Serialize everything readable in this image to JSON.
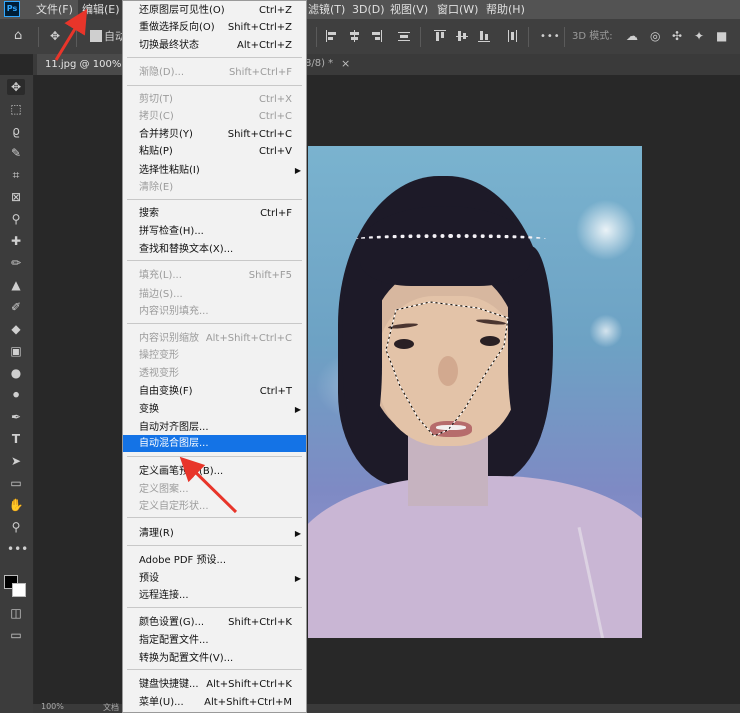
{
  "app": {
    "logo": "Ps"
  },
  "menubar": {
    "file": "文件(F)",
    "edit": "编辑(E)",
    "filter": "滤镜(T)",
    "threed": "3D(D)",
    "view": "视图(V)",
    "window": "窗口(W)",
    "help": "帮助(H)"
  },
  "options": {
    "auto_label": "自动",
    "threed_mode": "3D 模式:",
    "more": "•••"
  },
  "tabs": {
    "active": "11.jpg @ 100%(R",
    "second_suffix": "8/8) *",
    "close": "×"
  },
  "statusbar": {
    "zoom": "100%",
    "doc": "文档"
  },
  "edit_menu": {
    "items": [
      {
        "label": "还原图层可见性(O)",
        "shortcut": "Ctrl+Z",
        "disabled": false
      },
      {
        "label": "重做选择反向(O)",
        "shortcut": "Shift+Ctrl+Z",
        "disabled": false
      },
      {
        "label": "切换最终状态",
        "shortcut": "Alt+Ctrl+Z",
        "disabled": false
      },
      {
        "label": "渐隐(D)...",
        "shortcut": "Shift+Ctrl+F",
        "disabled": true
      },
      {
        "label": "剪切(T)",
        "shortcut": "Ctrl+X",
        "disabled": true
      },
      {
        "label": "拷贝(C)",
        "shortcut": "Ctrl+C",
        "disabled": true
      },
      {
        "label": "合并拷贝(Y)",
        "shortcut": "Shift+Ctrl+C",
        "disabled": false
      },
      {
        "label": "粘贴(P)",
        "shortcut": "Ctrl+V",
        "disabled": false
      },
      {
        "label": "选择性粘贴(I)",
        "shortcut": "",
        "disabled": false,
        "submenu": true
      },
      {
        "label": "清除(E)",
        "shortcut": "",
        "disabled": true
      },
      {
        "label": "搜索",
        "shortcut": "Ctrl+F",
        "disabled": false
      },
      {
        "label": "拼写检查(H)...",
        "shortcut": "",
        "disabled": false
      },
      {
        "label": "查找和替换文本(X)...",
        "shortcut": "",
        "disabled": false
      },
      {
        "label": "填充(L)...",
        "shortcut": "Shift+F5",
        "disabled": true
      },
      {
        "label": "描边(S)...",
        "shortcut": "",
        "disabled": true
      },
      {
        "label": "内容识别填充...",
        "shortcut": "",
        "disabled": true
      },
      {
        "label": "内容识别缩放",
        "shortcut": "Alt+Shift+Ctrl+C",
        "disabled": true
      },
      {
        "label": "操控变形",
        "shortcut": "",
        "disabled": true
      },
      {
        "label": "透视变形",
        "shortcut": "",
        "disabled": true
      },
      {
        "label": "自由变换(F)",
        "shortcut": "Ctrl+T",
        "disabled": false
      },
      {
        "label": "变换",
        "shortcut": "",
        "disabled": false,
        "submenu": true
      },
      {
        "label": "自动对齐图层...",
        "shortcut": "",
        "disabled": false
      },
      {
        "label": "自动混合图层...",
        "shortcut": "",
        "disabled": false,
        "highlighted": true
      },
      {
        "label": "定义画笔预设(B)...",
        "shortcut": "",
        "disabled": false
      },
      {
        "label": "定义图案...",
        "shortcut": "",
        "disabled": true
      },
      {
        "label": "定义自定形状...",
        "shortcut": "",
        "disabled": true
      },
      {
        "label": "清理(R)",
        "shortcut": "",
        "disabled": false,
        "submenu": true
      },
      {
        "label": "Adobe PDF 预设...",
        "shortcut": "",
        "disabled": false
      },
      {
        "label": "预设",
        "shortcut": "",
        "disabled": false,
        "submenu": true
      },
      {
        "label": "远程连接...",
        "shortcut": "",
        "disabled": false
      },
      {
        "label": "颜色设置(G)...",
        "shortcut": "Shift+Ctrl+K",
        "disabled": false
      },
      {
        "label": "指定配置文件...",
        "shortcut": "",
        "disabled": false
      },
      {
        "label": "转换为配置文件(V)...",
        "shortcut": "",
        "disabled": false
      },
      {
        "label": "键盘快捷键...",
        "shortcut": "Alt+Shift+Ctrl+K",
        "disabled": false
      },
      {
        "label": "菜单(U)...",
        "shortcut": "Alt+Shift+Ctrl+M",
        "disabled": false
      }
    ]
  },
  "colors": {
    "highlight": "#1473e6",
    "annotation": "#e8352a"
  }
}
